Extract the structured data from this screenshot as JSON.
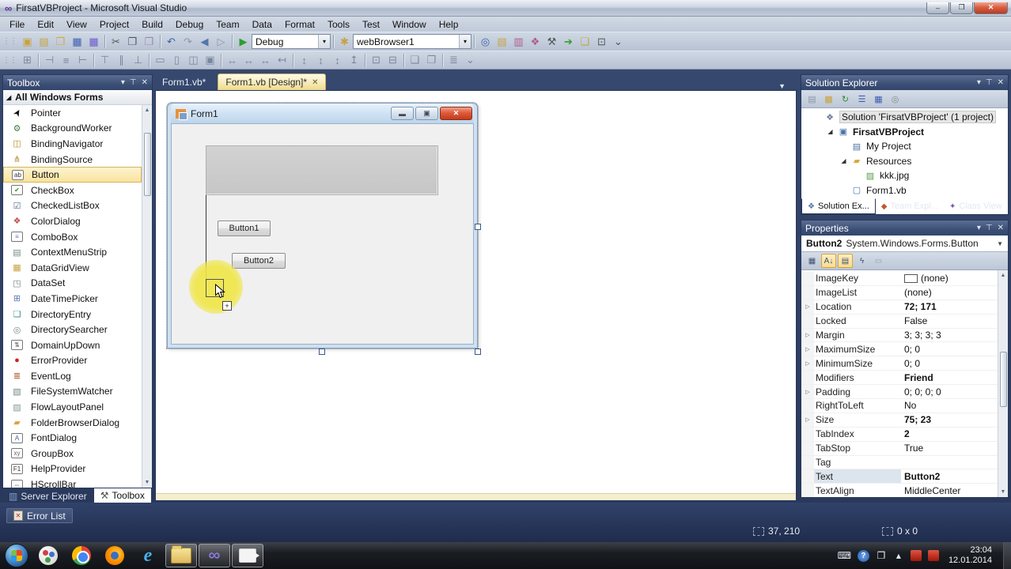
{
  "window": {
    "title": "FirsatVBProject - Microsoft Visual Studio",
    "buttons": {
      "minimize": "–",
      "restore": "❐",
      "close": "✕"
    }
  },
  "menu": {
    "items": [
      "File",
      "Edit",
      "View",
      "Project",
      "Build",
      "Debug",
      "Team",
      "Data",
      "Format",
      "Tools",
      "Test",
      "Window",
      "Help"
    ]
  },
  "toolbar1": {
    "debug_combo": "Debug",
    "browser_combo": "webBrowser1",
    "left_icons": [
      {
        "name": "new-project-icon",
        "glyph": "▣",
        "color": "#c9a23f",
        "caret": true
      },
      {
        "name": "add-new-item-icon",
        "glyph": "▤",
        "color": "#c9a23f",
        "caret": true
      },
      {
        "name": "open-file-icon",
        "glyph": "❒",
        "color": "#d9a740"
      },
      {
        "name": "save-icon",
        "glyph": "▦",
        "color": "#3f5fb0"
      },
      {
        "name": "save-all-icon",
        "glyph": "▦",
        "color": "#6a5acd"
      },
      {
        "name": "separator"
      },
      {
        "name": "cut-icon",
        "glyph": "✂",
        "color": "#555"
      },
      {
        "name": "copy-icon",
        "glyph": "❐",
        "color": "#556"
      },
      {
        "name": "paste-icon",
        "glyph": "❒",
        "color": "#98a"
      },
      {
        "name": "separator"
      },
      {
        "name": "undo-icon",
        "glyph": "↶",
        "color": "#3f5fb0",
        "caret": true
      },
      {
        "name": "redo-icon",
        "glyph": "↷",
        "color": "#8899aa",
        "caret": true
      },
      {
        "name": "navigate-back-icon",
        "glyph": "◀",
        "color": "#5577aa",
        "caret": true
      },
      {
        "name": "navigate-forward-icon",
        "glyph": "▷",
        "color": "#8899aa"
      },
      {
        "name": "separator"
      },
      {
        "name": "start-debugging-icon",
        "glyph": "▶",
        "color": "#2f9e2f"
      }
    ],
    "mid_icons": [
      {
        "name": "find-symbol-icon",
        "glyph": "✱",
        "color": "#c9a23f"
      }
    ],
    "right_icons": [
      {
        "name": "find-in-files-icon",
        "glyph": "◎",
        "color": "#3f5fb0"
      },
      {
        "name": "properties-window-icon",
        "glyph": "▤",
        "color": "#c9a23f"
      },
      {
        "name": "add-reference-icon",
        "glyph": "▥",
        "color": "#b05a8f"
      },
      {
        "name": "new-web-icon",
        "glyph": "❖",
        "color": "#b05a8f"
      },
      {
        "name": "customize-tools-icon",
        "glyph": "⚒",
        "color": "#555"
      },
      {
        "name": "start-page-icon",
        "glyph": "➔",
        "color": "#2f9e2f"
      },
      {
        "name": "export-template-icon",
        "glyph": "❏",
        "color": "#c9a23f"
      },
      {
        "name": "command-window-icon",
        "glyph": "⊡",
        "color": "#555",
        "caret": true
      },
      {
        "name": "toolbar-overflow-icon",
        "glyph": "⌄",
        "color": "#44506a"
      }
    ]
  },
  "toolbar2": {
    "icons": [
      {
        "name": "layout-grid-icon",
        "glyph": "⊞"
      },
      {
        "name": "separator"
      },
      {
        "name": "align-lefts-icon",
        "glyph": "⊣"
      },
      {
        "name": "align-centers-icon",
        "glyph": "≡"
      },
      {
        "name": "align-rights-icon",
        "glyph": "⊢"
      },
      {
        "name": "separator"
      },
      {
        "name": "align-tops-icon",
        "glyph": "⊤"
      },
      {
        "name": "align-middles-icon",
        "glyph": "∥"
      },
      {
        "name": "align-bottoms-icon",
        "glyph": "⊥"
      },
      {
        "name": "separator"
      },
      {
        "name": "same-width-icon",
        "glyph": "▭"
      },
      {
        "name": "size-to-grid-icon",
        "glyph": "▯"
      },
      {
        "name": "same-size-icon",
        "glyph": "◫"
      },
      {
        "name": "same-height-icon",
        "glyph": "▣"
      },
      {
        "name": "separator"
      },
      {
        "name": "h-spacing-equal-icon",
        "glyph": "↔"
      },
      {
        "name": "h-spacing-increase-icon",
        "glyph": "↔"
      },
      {
        "name": "h-spacing-decrease-icon",
        "glyph": "↔"
      },
      {
        "name": "h-spacing-remove-icon",
        "glyph": "↤"
      },
      {
        "name": "separator"
      },
      {
        "name": "v-spacing-equal-icon",
        "glyph": "↕"
      },
      {
        "name": "v-spacing-increase-icon",
        "glyph": "↕"
      },
      {
        "name": "v-spacing-decrease-icon",
        "glyph": "↕"
      },
      {
        "name": "v-spacing-remove-icon",
        "glyph": "↥"
      },
      {
        "name": "separator"
      },
      {
        "name": "center-horizontal-icon",
        "glyph": "⊡"
      },
      {
        "name": "center-vertical-icon",
        "glyph": "⊟"
      },
      {
        "name": "separator"
      },
      {
        "name": "bring-to-front-icon",
        "glyph": "❏"
      },
      {
        "name": "send-to-back-icon",
        "glyph": "❐"
      },
      {
        "name": "separator"
      },
      {
        "name": "tab-order-icon",
        "glyph": "≣"
      },
      {
        "name": "toolbar-overflow-icon",
        "glyph": "⌄"
      }
    ]
  },
  "toolbox": {
    "title": "Toolbox",
    "header_icons": [
      {
        "name": "window-position-icon",
        "glyph": "▾"
      },
      {
        "name": "auto-hide-pin-icon",
        "glyph": "⊤"
      },
      {
        "name": "close-icon",
        "glyph": "✕"
      }
    ],
    "group": "All Windows Forms",
    "items": [
      {
        "label": "Pointer",
        "icon": "pointer-icon",
        "glyph": "➤",
        "color": "#111",
        "rot": true
      },
      {
        "label": "BackgroundWorker",
        "icon": "background-worker-icon",
        "glyph": "⚙",
        "color": "#3a7d44"
      },
      {
        "label": "BindingNavigator",
        "icon": "binding-navigator-icon",
        "glyph": "◫",
        "color": "#b8912f"
      },
      {
        "label": "BindingSource",
        "icon": "binding-source-icon",
        "glyph": "⋔",
        "color": "#b8912f"
      },
      {
        "label": "Button",
        "icon": "button-icon",
        "glyph": "ab",
        "color": "#333",
        "boxed": true,
        "selected": true
      },
      {
        "label": "CheckBox",
        "icon": "checkbox-icon",
        "glyph": "✔",
        "color": "#2f8f2f",
        "boxed": true
      },
      {
        "label": "CheckedListBox",
        "icon": "checked-listbox-icon",
        "glyph": "☑",
        "color": "#5b6c8f"
      },
      {
        "label": "ColorDialog",
        "icon": "color-dialog-icon",
        "glyph": "❖",
        "color": "#c05050"
      },
      {
        "label": "ComboBox",
        "icon": "combobox-icon",
        "glyph": "≡",
        "color": "#5b7ab0",
        "boxed": true
      },
      {
        "label": "ContextMenuStrip",
        "icon": "context-menu-strip-icon",
        "glyph": "▤",
        "color": "#788"
      },
      {
        "label": "DataGridView",
        "icon": "data-grid-view-icon",
        "glyph": "▦",
        "color": "#c9a23f"
      },
      {
        "label": "DataSet",
        "icon": "dataset-icon",
        "glyph": "◳",
        "color": "#788"
      },
      {
        "label": "DateTimePicker",
        "icon": "date-time-picker-icon",
        "glyph": "⊞",
        "color": "#5b7ab0"
      },
      {
        "label": "DirectoryEntry",
        "icon": "directory-entry-icon",
        "glyph": "❏",
        "color": "#3f8f8f"
      },
      {
        "label": "DirectorySearcher",
        "icon": "directory-searcher-icon",
        "glyph": "◎",
        "color": "#788"
      },
      {
        "label": "DomainUpDown",
        "icon": "domain-up-down-icon",
        "glyph": "⇅",
        "color": "#555",
        "boxed": true
      },
      {
        "label": "ErrorProvider",
        "icon": "error-provider-icon",
        "glyph": "●",
        "color": "#cc2222"
      },
      {
        "label": "EventLog",
        "icon": "event-log-icon",
        "glyph": "≣",
        "color": "#b05a2f"
      },
      {
        "label": "FileSystemWatcher",
        "icon": "file-system-watcher-icon",
        "glyph": "▧",
        "color": "#788"
      },
      {
        "label": "FlowLayoutPanel",
        "icon": "flow-layout-panel-icon",
        "glyph": "▨",
        "color": "#899"
      },
      {
        "label": "FolderBrowserDialog",
        "icon": "folder-browser-dialog-icon",
        "glyph": "▰",
        "color": "#d9a740"
      },
      {
        "label": "FontDialog",
        "icon": "font-dialog-icon",
        "glyph": "A",
        "color": "#3f5fb0",
        "boxed": true
      },
      {
        "label": "GroupBox",
        "icon": "groupbox-icon",
        "glyph": "xy",
        "color": "#666",
        "boxed": true
      },
      {
        "label": "HelpProvider",
        "icon": "help-provider-icon",
        "glyph": "F1",
        "color": "#333",
        "boxed": true
      },
      {
        "label": "HScrollBar",
        "icon": "hscrollbar-icon",
        "glyph": "⇔",
        "color": "#555",
        "boxed": true
      }
    ]
  },
  "bottom_left_tabs": [
    {
      "label": "Server Explorer",
      "icon": "server-explorer-icon",
      "glyph": "▥",
      "color": "#7da0d0",
      "active": false
    },
    {
      "label": "Toolbox",
      "icon": "toolbox-icon",
      "glyph": "⚒",
      "color": "#555",
      "active": true
    }
  ],
  "doc_tabs": [
    {
      "label": "Form1.vb*",
      "active": false,
      "close": ""
    },
    {
      "label": "Form1.vb [Design]*",
      "active": true,
      "close": "✕"
    }
  ],
  "designer": {
    "form_title": "Form1",
    "form_buttons": {
      "minimize": "▬",
      "maximize": "▣",
      "close": "✕"
    },
    "button1": "Button1",
    "button2": "Button2",
    "plus_badge": "+"
  },
  "solution_explorer": {
    "title": "Solution Explorer",
    "header_icons": [
      {
        "name": "window-position-icon",
        "glyph": "▾"
      },
      {
        "name": "auto-hide-pin-icon",
        "glyph": "⊤"
      },
      {
        "name": "close-icon",
        "glyph": "✕"
      }
    ],
    "toolbar_icons": [
      {
        "name": "properties-icon",
        "glyph": "▤",
        "color": "#8a97ab"
      },
      {
        "name": "show-all-files-icon",
        "glyph": "▩",
        "color": "#c9a23f"
      },
      {
        "name": "refresh-icon",
        "glyph": "↻",
        "color": "#2f8f2f"
      },
      {
        "name": "view-code-icon",
        "glyph": "☰",
        "color": "#3f5fb0"
      },
      {
        "name": "view-designer-icon",
        "glyph": "▦",
        "color": "#3f5fb0"
      },
      {
        "name": "view-class-diagram-icon",
        "glyph": "◎",
        "color": "#888"
      }
    ],
    "tree": [
      {
        "label": "Solution 'FirsatVBProject' (1 project)",
        "icon": "solution-icon",
        "glyph": "❖",
        "color": "#6b7b96",
        "indent": 0,
        "expander": "",
        "hl": true,
        "bold": false
      },
      {
        "label": "FirsatVBProject",
        "icon": "vb-project-icon",
        "glyph": "▣",
        "color": "#4a72aa",
        "indent": 1,
        "expander": "◢",
        "bold": true
      },
      {
        "label": "My Project",
        "icon": "my-project-icon",
        "glyph": "▤",
        "color": "#4a72aa",
        "indent": 2,
        "expander": "",
        "bold": false
      },
      {
        "label": "Resources",
        "icon": "folder-icon",
        "glyph": "▰",
        "color": "#d9a740",
        "indent": 2,
        "expander": "◢",
        "bold": false
      },
      {
        "label": "kkk.jpg",
        "icon": "image-file-icon",
        "glyph": "▨",
        "color": "#5a9e4a",
        "indent": 3,
        "expander": "",
        "bold": false
      },
      {
        "label": "Form1.vb",
        "icon": "form-file-icon",
        "glyph": "▢",
        "color": "#4a72aa",
        "indent": 2,
        "expander": "",
        "bold": false
      }
    ],
    "tabs": [
      {
        "label": "Solution Ex...",
        "glyph": "❖",
        "color": "#4a72aa",
        "active": true
      },
      {
        "label": "Team Expl...",
        "glyph": "◆",
        "color": "#c05a2f",
        "active": false
      },
      {
        "label": "Class View",
        "glyph": "✦",
        "color": "#7a5ab0",
        "active": false
      }
    ]
  },
  "properties": {
    "title": "Properties",
    "header_icons": [
      {
        "name": "window-position-icon",
        "glyph": "▾"
      },
      {
        "name": "auto-hide-pin-icon",
        "glyph": "⊤"
      },
      {
        "name": "close-icon",
        "glyph": "✕"
      }
    ],
    "object_name": "Button2",
    "object_type": "System.Windows.Forms.Button",
    "toolbar_icons": [
      {
        "name": "categorized-icon",
        "glyph": "▦",
        "pressed": false
      },
      {
        "name": "alphabetical-icon",
        "glyph": "A↓",
        "pressed": true
      },
      {
        "name": "properties-view-icon",
        "glyph": "▤",
        "pressed": true
      },
      {
        "name": "events-icon",
        "glyph": "ϟ",
        "pressed": false
      },
      {
        "name": "property-pages-icon",
        "glyph": "▭",
        "pressed": false,
        "disabled": true
      }
    ],
    "rows": [
      {
        "label": "ImageKey",
        "value": "(none)",
        "swatch": true
      },
      {
        "label": "ImageList",
        "value": "(none)"
      },
      {
        "label": "Location",
        "value": "72; 171",
        "expand": "▷",
        "bold": true
      },
      {
        "label": "Locked",
        "value": "False"
      },
      {
        "label": "Margin",
        "value": "3; 3; 3; 3",
        "expand": "▷"
      },
      {
        "label": "MaximumSize",
        "value": "0; 0",
        "expand": "▷"
      },
      {
        "label": "MinimumSize",
        "value": "0; 0",
        "expand": "▷"
      },
      {
        "label": "Modifiers",
        "value": "Friend",
        "bold": true
      },
      {
        "label": "Padding",
        "value": "0; 0; 0; 0",
        "expand": "▷"
      },
      {
        "label": "RightToLeft",
        "value": "No"
      },
      {
        "label": "Size",
        "value": "75; 23",
        "expand": "▷",
        "bold": true
      },
      {
        "label": "TabIndex",
        "value": "2",
        "bold": true
      },
      {
        "label": "TabStop",
        "value": "True"
      },
      {
        "label": "Tag",
        "value": ""
      },
      {
        "label": "Text",
        "value": "Button2",
        "bold": true,
        "selected": true
      },
      {
        "label": "TextAlign",
        "value": "MiddleCenter"
      }
    ]
  },
  "bottombar": {
    "error_list": "Error List",
    "status_position": "37, 210",
    "status_size": "0 x 0"
  },
  "taskbar": {
    "clock": {
      "time": "23:04",
      "date": "12.01.2014"
    },
    "tray_icons": [
      {
        "name": "keyboard-tray-icon",
        "glyph": "⌨",
        "cls": ""
      },
      {
        "name": "help-tray-icon",
        "glyph": "?",
        "cls": "help"
      },
      {
        "name": "window-tray-icon",
        "glyph": "❐",
        "cls": ""
      },
      {
        "name": "show-hidden-icons",
        "glyph": "▴",
        "cls": ""
      },
      {
        "name": "recorder-tray-icon",
        "glyph": "",
        "cls": "red"
      },
      {
        "name": "capture-tray-icon",
        "glyph": "",
        "cls": "red"
      }
    ]
  }
}
